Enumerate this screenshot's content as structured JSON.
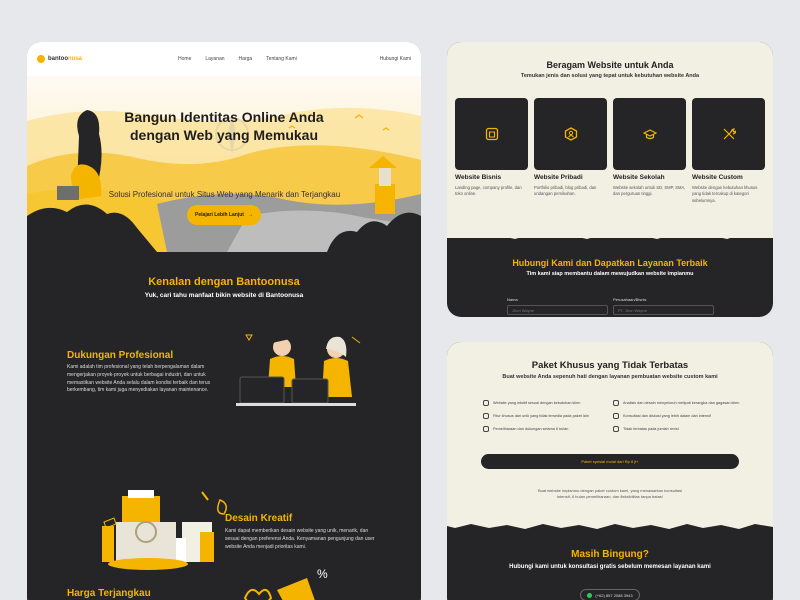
{
  "nav": {
    "brand_prefix": "bantoo",
    "brand_suffix": "nusa",
    "links": [
      "Home",
      "Layanan",
      "Harga",
      "Tentang Kami"
    ],
    "cta": "Hubungi Kami"
  },
  "hero": {
    "title": "Bangun Identitas Online Anda dengan Web yang Memukau",
    "subtitle": "Solusi Profesional untuk Situs Web yang Menarik dan Terjangkau",
    "button": "Pelajari Lebih Lanjut"
  },
  "intro": {
    "title": "Kenalan dengan Bantoonusa",
    "subtitle": "Yuk, cari tahu manfaat bikin website di Bantoonusa"
  },
  "features": [
    {
      "title": "Dukungan Profesional",
      "text": "Kami adalah tim profesional yang telah berpengalaman dalam mengerjakan proyek-proyek untuk berbagai industri, dan untuk memastikan website Anda selalu dalam kondisi terbaik dan terus berkembang, tim kami juga menyediakan layanan maintenance."
    },
    {
      "title": "Desain Kreatif",
      "text": "Kami dapat memberikan desain website yang unik, menarik, dan sesuai dengan preferensi Anda. Kenyamanan pengunjung dan user website Anda menjadi prioritas kami."
    },
    {
      "title": "Harga Terjangkau",
      "text": ""
    }
  ],
  "services": {
    "title": "Beragam Website untuk Anda",
    "subtitle": "Temukan jenis dan solusi yang tepat untuk kebutuhan website Anda",
    "items": [
      {
        "name": "Website Bisnis",
        "desc": "Landing page, company profile, dan toko online.",
        "icon": "store-icon"
      },
      {
        "name": "Website Pribadi",
        "desc": "Portfolio pribadi, blog pribadi, dan undangan pernikahan.",
        "icon": "user-badge-icon"
      },
      {
        "name": "Website Sekolah",
        "desc": "Website sekolah untuk SD, SMP, SMA, dan perguruan tinggi.",
        "icon": "graduation-cap-icon"
      },
      {
        "name": "Website Custom",
        "desc": "Website dengan kebutuhan khusus yang tidak tercakup di kategori sebelumnya.",
        "icon": "tools-icon"
      }
    ]
  },
  "contact": {
    "title": "Hubungi Kami dan Dapatkan Layanan Terbaik",
    "subtitle": "Tim kami siap membantu dalam mewujudkan website impianmu",
    "fields": [
      {
        "label": "Nama",
        "placeholder": "Jhon Wayne"
      },
      {
        "label": "Perusahaan/Bisnis",
        "placeholder": "PT. Jhon Wayne"
      }
    ]
  },
  "package": {
    "title": "Paket Khusus yang Tidak Terbatas",
    "subtitle": "Buat website Anda sepenuh hati dengan layanan pembuatan website custom kami",
    "features_left": [
      "Website yang intuitif sesuai dengan kebutuhan klien",
      "Fitur khusus dan unik yang tidak tersedia pada paket lain",
      "Pemeliharaan dan dukungan selama 6 bulan"
    ],
    "features_right": [
      "Analisis dan desain menyeluruh meliputi kerangka dan gagasan klien",
      "Konsultasi dan diskusi yang lebih dalam dan intensif",
      "Tidak terbatas pada jumlah revisi"
    ],
    "button": "Paket spesial mulai dari Rp 8 jt+",
    "note": "Buat website impianmu dengan paket custom kami, yang menawarkan konsultasi intensif, 6 bulan pemeliharaan, dan fleksibilitas tanpa batas!"
  },
  "help": {
    "title": "Masih Bingung?",
    "subtitle": "Hubungi kami untuk konsultasi gratis sebelum memesan layanan kami",
    "whatsapp": "(+62) 857 2088 3943"
  },
  "colors": {
    "accent": "#f4b400",
    "dark": "#252528",
    "cream": "#f2efe3"
  }
}
